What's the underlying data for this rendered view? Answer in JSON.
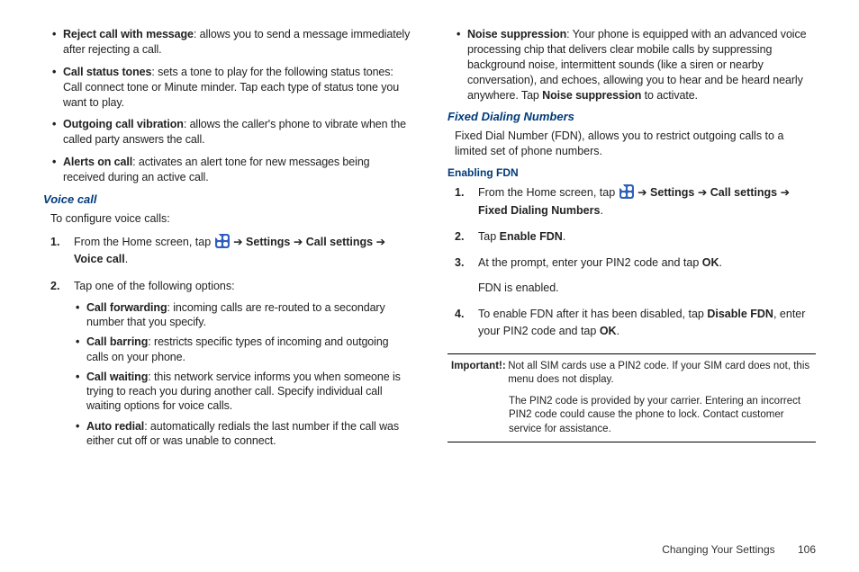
{
  "left": {
    "bullets": [
      {
        "term": "Reject call with message",
        "desc": ": allows you to send a message immediately after rejecting a call."
      },
      {
        "term": "Call status tones",
        "desc": ": sets a tone to play for the following status tones: Call connect tone or Minute minder. Tap each type of status tone you want to play."
      },
      {
        "term": "Outgoing call vibration",
        "desc": ": allows the caller's phone to vibrate when the called party answers the call."
      },
      {
        "term": "Alerts on call",
        "desc": ": activates an alert tone for new messages being received during an active call."
      }
    ],
    "voice_call_heading": "Voice call",
    "voice_call_intro": "To configure voice calls:",
    "step1_prefix": "From the Home screen, tap ",
    "step1_arrow": " ➔ ",
    "step1_settings": "Settings",
    "step1_call_settings": "Call settings",
    "step1_voice_call": "Voice call",
    "step2": "Tap one of the following options:",
    "step2_bullets": [
      {
        "term": "Call forwarding",
        "desc": ": incoming calls are re-routed to a secondary number that you specify."
      },
      {
        "term": "Call barring",
        "desc": ": restricts specific types of incoming and outgoing calls on your phone."
      },
      {
        "term": "Call waiting",
        "desc": ": this network service informs you when someone is trying to reach you during another call. Specify individual call waiting options for voice calls."
      },
      {
        "term": "Auto redial",
        "desc": ": automatically redials the last number if the call was either cut off or was unable to connect."
      }
    ]
  },
  "right": {
    "noise": {
      "term": "Noise suppression",
      "desc_a": ": Your phone is equipped with an advanced voice processing chip that delivers clear mobile calls by suppressing background noise, intermittent sounds (like a siren or nearby conversation), and echoes, allowing you to hear and be heard nearly anywhere. Tap ",
      "desc_bold": "Noise suppression",
      "desc_b": " to activate."
    },
    "fdn_heading": "Fixed Dialing Numbers",
    "fdn_intro": "Fixed Dial Number (FDN), allows you to restrict outgoing calls to a limited set of phone numbers.",
    "enabling_heading": "Enabling FDN",
    "step1_prefix": "From the Home screen, tap ",
    "arrow": " ➔ ",
    "settings": "Settings",
    "call_settings": "Call settings",
    "fdn_label": "Fixed Dialing Numbers",
    "step2_prefix": "Tap ",
    "step2_bold": "Enable FDN",
    "step3_a": "At the prompt, enter your PIN2 code and tap ",
    "ok": "OK",
    "step3_b": "FDN is enabled.",
    "step4_a": "To enable FDN after it has been disabled, tap ",
    "disable_fdn": "Disable FDN",
    "step4_b": ", enter your PIN2 code and tap ",
    "important_label": "Important!:",
    "important_p1": "Not all SIM cards use a PIN2 code. If your SIM card does not, this menu does not display.",
    "important_p2": "The PIN2 code is provided by your carrier. Entering an incorrect PIN2 code could cause the phone to lock. Contact customer service for assistance."
  },
  "footer": {
    "section": "Changing Your Settings",
    "page": "106"
  },
  "nums": {
    "n1": "1.",
    "n2": "2.",
    "n3": "3.",
    "n4": "4."
  },
  "period": "."
}
